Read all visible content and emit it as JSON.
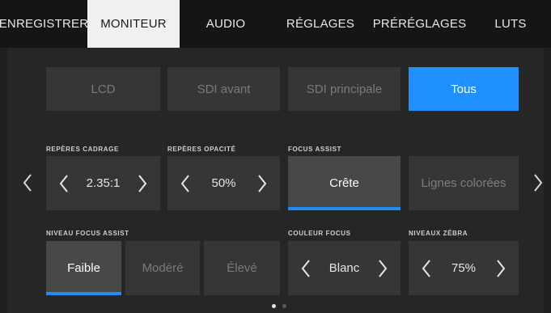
{
  "tabs": [
    {
      "label": "ENREGISTRER",
      "active": false
    },
    {
      "label": "MONITEUR",
      "active": true
    },
    {
      "label": "AUDIO",
      "active": false
    },
    {
      "label": "RÉGLAGES",
      "active": false
    },
    {
      "label": "PRÉRÉGLAGES",
      "active": false
    },
    {
      "label": "LUTS",
      "active": false
    }
  ],
  "outputs": {
    "lcd": "LCD",
    "sdi_front": "SDI avant",
    "sdi_main": "SDI principale",
    "all": "Tous",
    "selected": "Tous"
  },
  "frame_guides": {
    "label": "REPÈRES CADRAGE",
    "value": "2.35:1"
  },
  "guide_opacity": {
    "label": "REPÈRES OPACITÉ",
    "value": "50%"
  },
  "focus_assist": {
    "label": "FOCUS ASSIST",
    "options": [
      "Crête",
      "Lignes colorées"
    ],
    "selected": "Crête"
  },
  "focus_level": {
    "label": "NIVEAU FOCUS ASSIST",
    "options": [
      "Faible",
      "Modéré",
      "Élevé"
    ],
    "selected": "Faible"
  },
  "focus_color": {
    "label": "COULEUR FOCUS",
    "value": "Blanc"
  },
  "zebra": {
    "label": "NIVEAUX ZÉBRA",
    "value": "75%"
  },
  "pagination": {
    "current": 1,
    "total": 2
  },
  "colors": {
    "accent": "#1e90ff",
    "tab_active_bg": "#f0f0f0",
    "topbar_bg": "#151515"
  }
}
